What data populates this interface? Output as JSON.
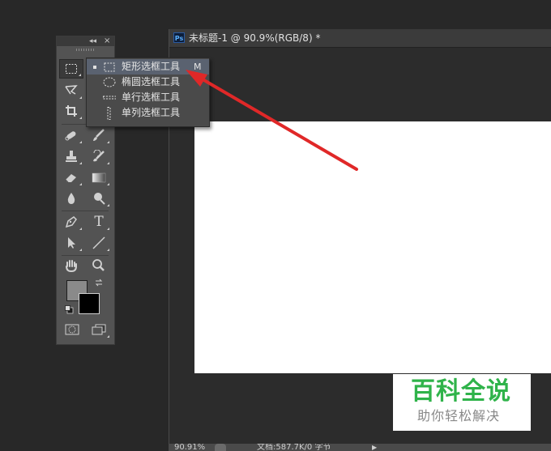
{
  "tools_panel": {
    "collapse_glyph": "◂◂",
    "close_glyph": "×",
    "tools": [
      {
        "name": "rectangular-marquee-tool-icon",
        "active": true
      },
      {
        "name": "lasso-tool-icon"
      },
      {
        "name": "crop-tool-icon"
      },
      {
        "name": "spot-healing-brush-icon"
      },
      {
        "name": "brush-tool-icon"
      },
      {
        "name": "clone-stamp-icon"
      },
      {
        "name": "history-brush-icon"
      },
      {
        "name": "eraser-tool-icon"
      },
      {
        "name": "gradient-tool-icon"
      },
      {
        "name": "blur-tool-icon"
      },
      {
        "name": "dodge-tool-icon"
      },
      {
        "name": "pen-tool-icon"
      },
      {
        "name": "type-tool-icon"
      },
      {
        "name": "path-selection-icon"
      },
      {
        "name": "line-tool-icon"
      },
      {
        "name": "hand-tool-icon"
      },
      {
        "name": "zoom-tool-icon"
      },
      {
        "name": "quick-mask-icon"
      },
      {
        "name": "screen-mode-icon"
      }
    ],
    "type_tool_glyph": "T",
    "foreground_color": "#8a8a8a",
    "background_color": "#000000"
  },
  "flyout": {
    "items": [
      {
        "label": "矩形选框工具",
        "shortcut": "M",
        "selected": true
      },
      {
        "label": "椭圆选框工具",
        "shortcut": ""
      },
      {
        "label": "单行选框工具",
        "shortcut": ""
      },
      {
        "label": "单列选框工具",
        "shortcut": ""
      }
    ]
  },
  "document": {
    "app_badge": "Ps",
    "title": "未标题-1 @ 90.9%(RGB/8) *",
    "zoom": "90.91%",
    "info": "文档:587.7K/0 字节",
    "canvas_color": "#ffffff"
  },
  "annotation": {
    "arrow_color": "#e02828"
  },
  "watermark": {
    "main": "百科全说",
    "sub": "助你轻松解决",
    "color": "#2fb34a"
  }
}
